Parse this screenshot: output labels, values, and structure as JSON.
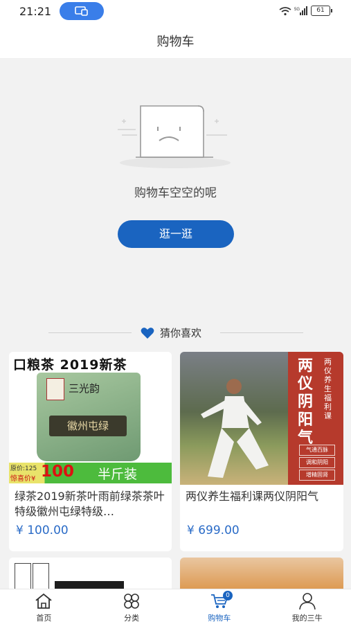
{
  "status": {
    "time": "21:21",
    "battery": "61"
  },
  "header": {
    "title": "购物车"
  },
  "empty": {
    "message": "购物车空空的呢",
    "button_label": "逛一逛"
  },
  "recommend": {
    "heading": "猜你喜欢"
  },
  "products": [
    {
      "title": "绿茶2019新茶叶雨前绿茶茶叶特级徽州屯绿特级…",
      "price": "¥ 100.00",
      "banner_text": "口粮茶 2019新茶",
      "brand_text": "三光韵",
      "package_text": "徽州屯绿",
      "promo_orig": "原价:125",
      "promo_now": "惊喜价¥",
      "promo_price": "100",
      "promo_tag": "半斤装"
    },
    {
      "title": "两仪养生福利课两仪阴阳气",
      "price": "¥ 699.00",
      "panel_title": "两仪阴阳气",
      "panel_subtitle": "两仪养生福利课",
      "panel_tags": [
        "气通百脉",
        "调和阴阳",
        "增精固肾"
      ]
    }
  ],
  "tabs": [
    {
      "label": "首页",
      "icon": "home-icon"
    },
    {
      "label": "分类",
      "icon": "category-icon"
    },
    {
      "label": "购物车",
      "icon": "cart-icon",
      "active": true,
      "badge": "0"
    },
    {
      "label": "我的三牛",
      "icon": "user-icon"
    }
  ],
  "colors": {
    "accent": "#1a64c0",
    "price": "#2a6bc7",
    "background": "#f2f2f2"
  }
}
